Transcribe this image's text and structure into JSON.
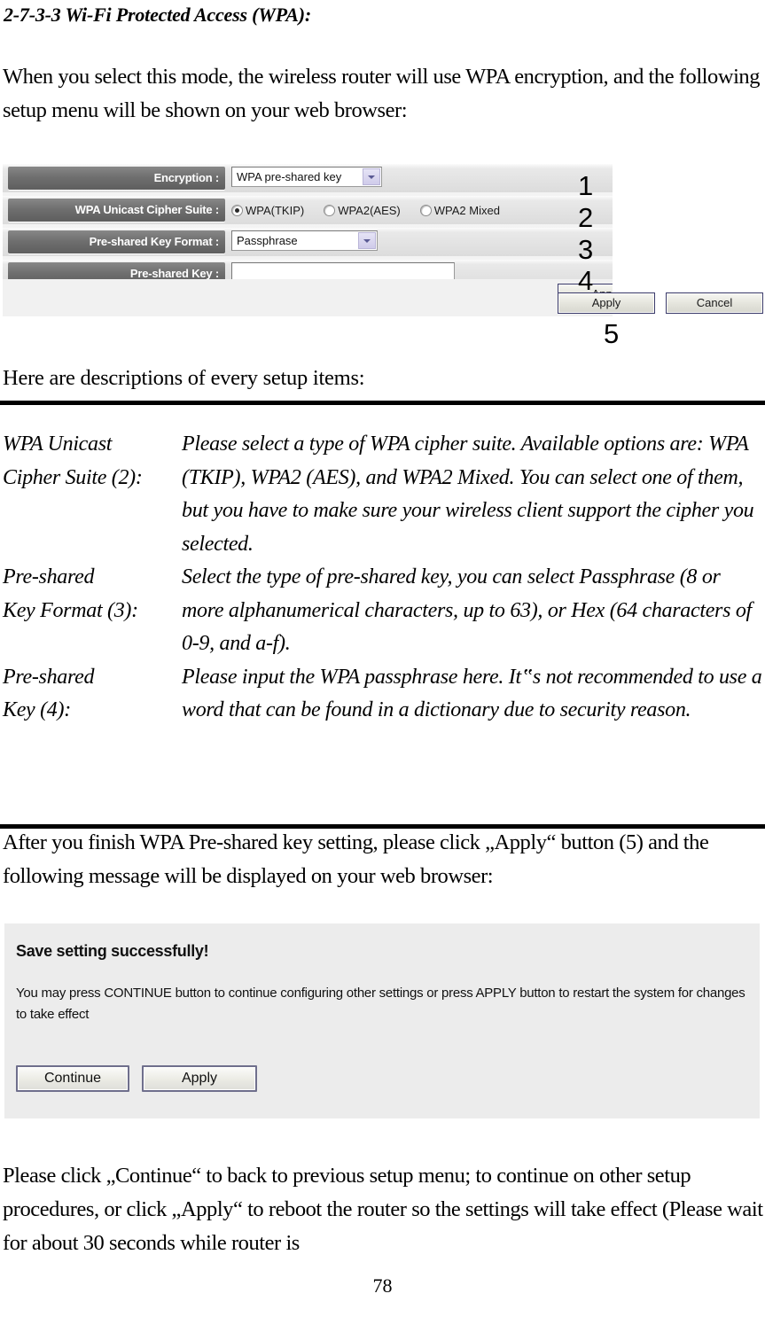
{
  "document": {
    "heading": "2-7-3-3 Wi-Fi Protected Access (WPA):",
    "intro_paragraph": "When you select this mode, the wireless router will use WPA encryption, and the following setup menu will be shown on your web browser:",
    "descriptions_lead": "Here are descriptions of every setup items:",
    "after_apply_paragraph": "After you finish WPA Pre-shared key setting, please click „Apply“ button (5) and the following message will be displayed on your web browser:",
    "closing_paragraph": "Please click „Continue“ to back to previous setup menu; to continue on other setup procedures, or click „Apply“ to reboot the router so the settings will take effect (Please wait for about 30 seconds while router is",
    "page_number": "78"
  },
  "router_ui": {
    "rows": [
      {
        "label": "Encryption :",
        "control": "select",
        "value": "WPA pre-shared key",
        "callout": "1"
      },
      {
        "label": "WPA Unicast Cipher Suite :",
        "control": "radio-group",
        "callout": "2",
        "options": [
          {
            "label": "WPA(TKIP)",
            "checked": true
          },
          {
            "label": "WPA2(AES)",
            "checked": false
          },
          {
            "label": "WPA2 Mixed",
            "checked": false
          }
        ]
      },
      {
        "label": "Pre-shared Key Format :",
        "control": "select",
        "value": "Passphrase",
        "callout": "3"
      },
      {
        "label": "Pre-shared Key :",
        "control": "text",
        "value": "",
        "callout": "4"
      }
    ],
    "buttons": {
      "apply": "Apply",
      "cancel": "Cancel",
      "apply_callout": "5"
    }
  },
  "descriptions": [
    {
      "term_line1": "WPA Unicast",
      "term_line2": "Cipher Suite (2):",
      "definition": "Please select a type of WPA cipher suite. Available options are: WPA (TKIP), WPA2 (AES), and WPA2 Mixed. You can select one of them, but you have to make sure your wireless client support the cipher you selected."
    },
    {
      "term_line1": "Pre-shared",
      "term_line2": "Key Format (3):",
      "definition": "Select the type of pre-shared key, you can select Passphrase (8 or more alphanumerical characters, up to 63), or Hex (64 characters of 0-9, and a-f)."
    },
    {
      "term_line1": "Pre-shared",
      "term_line2": "Key (4):",
      "definition": "Please input the WPA passphrase here. It‟s not recommended to use a word that can be found in a dictionary due to security reason."
    }
  ],
  "message_box": {
    "title": "Save setting successfully!",
    "body": "You may press CONTINUE button to continue configuring other settings or press APPLY button to restart the system for changes to take effect",
    "continue_label": "Continue",
    "apply_label": "Apply"
  },
  "colors": {
    "label_cell_dark": "#6f6f6f",
    "page_background": "#ffffff",
    "message_box_background": "#ececec",
    "select_arrow": "#cfcbea"
  }
}
